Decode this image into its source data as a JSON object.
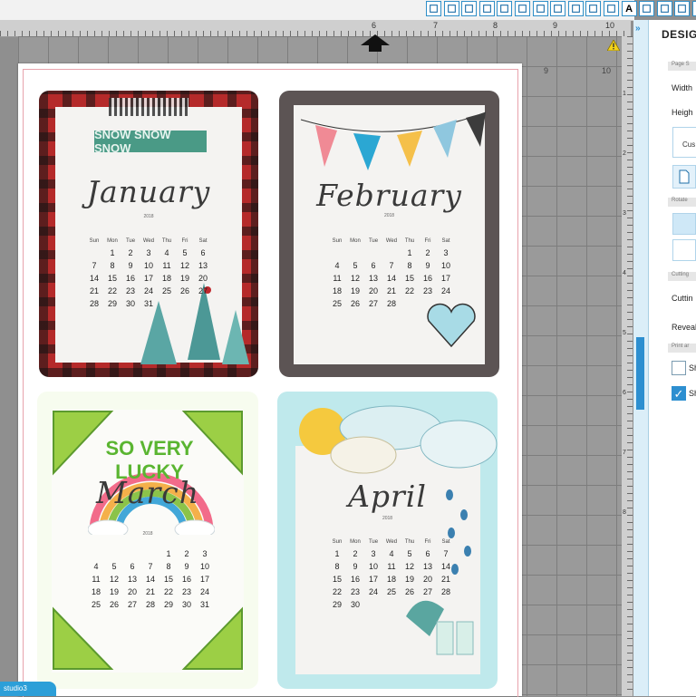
{
  "app": {
    "logo_text": "studio3"
  },
  "toolbar": {
    "tools": [
      "eraser-icon",
      "grid-icon",
      "grid-2-icon",
      "pentagon-icon",
      "offset-icon",
      "polygon-icon",
      "trace-icon",
      "search-icon",
      "knife-icon",
      "lines-icon",
      "lines-2-icon",
      "text-icon",
      "move-icon",
      "pen-icon",
      "shapes-icon",
      "fill-icon",
      "send-icon"
    ],
    "text_tool": "A"
  },
  "ruler": {
    "top_numbers": [
      "6",
      "7",
      "8",
      "9",
      "10"
    ],
    "page_numbers": [
      "9",
      "10"
    ],
    "right_numbers": [
      "1",
      "2",
      "3",
      "4",
      "5",
      "6",
      "7",
      "8"
    ]
  },
  "panel": {
    "title": "DESIGN",
    "sections": [
      "Page S",
      "Rotate",
      "Cutting",
      "Print ar"
    ],
    "width_label": "Width",
    "height_label": "Heigh",
    "preset_label": "Cus",
    "cutting_label": "Cuttin",
    "reveal_label": "Reveal",
    "check1_label": "Sh",
    "check2_label": "Sh",
    "check2_mark": "✓"
  },
  "cards": {
    "january": {
      "banner": "SNOW SNOW SNOW",
      "month": "January",
      "year": "2018",
      "days": [
        "Sun",
        "Mon",
        "Tue",
        "Wed",
        "Thu",
        "Fri",
        "Sat"
      ],
      "rows": [
        [
          "",
          "1",
          "2",
          "3",
          "4",
          "5",
          "6"
        ],
        [
          "7",
          "8",
          "9",
          "10",
          "11",
          "12",
          "13"
        ],
        [
          "14",
          "15",
          "16",
          "17",
          "18",
          "19",
          "20"
        ],
        [
          "21",
          "22",
          "23",
          "24",
          "25",
          "26",
          "27"
        ],
        [
          "28",
          "29",
          "30",
          "31",
          "",
          "",
          ""
        ]
      ]
    },
    "february": {
      "month": "February",
      "year": "2018",
      "days": [
        "Sun",
        "Mon",
        "Tue",
        "Wed",
        "Thu",
        "Fri",
        "Sat"
      ],
      "rows": [
        [
          "",
          "",
          "",
          "",
          "1",
          "2",
          "3"
        ],
        [
          "4",
          "5",
          "6",
          "7",
          "8",
          "9",
          "10"
        ],
        [
          "11",
          "12",
          "13",
          "14",
          "15",
          "16",
          "17"
        ],
        [
          "18",
          "19",
          "20",
          "21",
          "22",
          "23",
          "24"
        ],
        [
          "25",
          "26",
          "27",
          "28",
          "",
          "",
          ""
        ]
      ]
    },
    "march": {
      "banner": "SO VERY LUCKY",
      "month": "March",
      "year": "2018",
      "rows": [
        [
          "",
          "",
          "",
          "",
          "1",
          "2",
          "3"
        ],
        [
          "4",
          "5",
          "6",
          "7",
          "8",
          "9",
          "10"
        ],
        [
          "11",
          "12",
          "13",
          "14",
          "15",
          "16",
          "17"
        ],
        [
          "18",
          "19",
          "20",
          "21",
          "22",
          "23",
          "24"
        ],
        [
          "25",
          "26",
          "27",
          "28",
          "29",
          "30",
          "31"
        ]
      ]
    },
    "april": {
      "month": "April",
      "year": "2018",
      "days": [
        "Sun",
        "Mon",
        "Tue",
        "Wed",
        "Thu",
        "Fri",
        "Sat"
      ],
      "rows": [
        [
          "1",
          "2",
          "3",
          "4",
          "5",
          "6",
          "7"
        ],
        [
          "8",
          "9",
          "10",
          "11",
          "12",
          "13",
          "14"
        ],
        [
          "15",
          "16",
          "17",
          "18",
          "19",
          "20",
          "21"
        ],
        [
          "22",
          "23",
          "24",
          "25",
          "26",
          "27",
          "28"
        ],
        [
          "29",
          "30",
          "",
          "",
          "",
          "",
          ""
        ]
      ]
    }
  }
}
